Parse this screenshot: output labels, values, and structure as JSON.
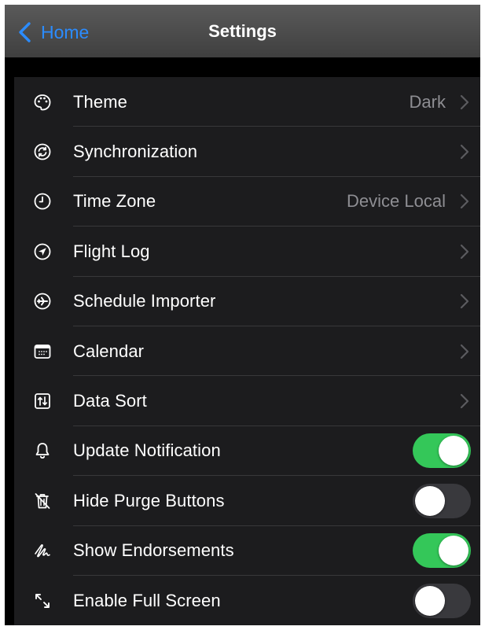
{
  "navbar": {
    "back_label": "Home",
    "title": "Settings"
  },
  "colors": {
    "accent": "#2b8cff",
    "toggle_on": "#34c759",
    "toggle_off": "#39393d",
    "row_background": "#1c1c1e",
    "secondary_text": "#8e8e93"
  },
  "rows": [
    {
      "label": "Theme",
      "icon": "palette-icon",
      "value": "Dark",
      "chevron": true
    },
    {
      "label": "Synchronization",
      "icon": "sync-icon",
      "chevron": true
    },
    {
      "label": "Time Zone",
      "icon": "clock-icon",
      "value": "Device Local",
      "chevron": true
    },
    {
      "label": "Flight Log",
      "icon": "location-arrow-icon",
      "chevron": true
    },
    {
      "label": "Schedule Importer",
      "icon": "airplane-icon",
      "chevron": true
    },
    {
      "label": "Calendar",
      "icon": "calendar-icon",
      "chevron": true
    },
    {
      "label": "Data Sort",
      "icon": "sort-icon",
      "chevron": true
    },
    {
      "label": "Update Notification",
      "icon": "bell-icon",
      "toggle": true
    },
    {
      "label": "Hide Purge Buttons",
      "icon": "trash-icon",
      "toggle": false
    },
    {
      "label": "Show Endorsements",
      "icon": "signature-icon",
      "toggle": true
    },
    {
      "label": "Enable Full Screen",
      "icon": "expand-icon",
      "toggle": false
    }
  ]
}
